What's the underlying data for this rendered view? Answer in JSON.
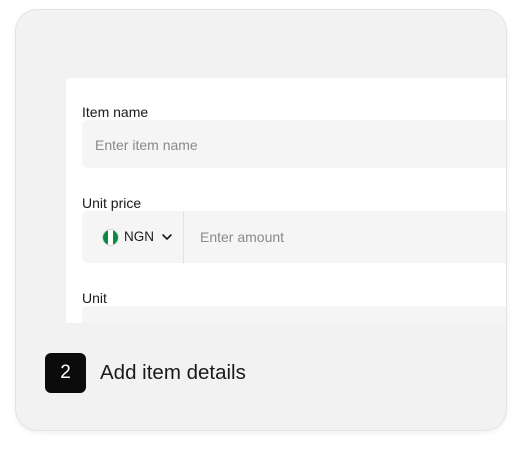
{
  "form": {
    "item_name": {
      "label": "Item name",
      "placeholder": "Enter item name"
    },
    "unit_price": {
      "label": "Unit price",
      "currency_code": "NGN",
      "currency_flag_icon": "nigeria-flag-icon",
      "placeholder": "Enter amount"
    },
    "unit": {
      "label": "Unit"
    }
  },
  "step": {
    "number": "2",
    "title": "Add item details"
  },
  "colors": {
    "flag_green": "#0a8a47",
    "step_badge": "#0b0b0b",
    "card_bg": "#f2f2f2"
  }
}
